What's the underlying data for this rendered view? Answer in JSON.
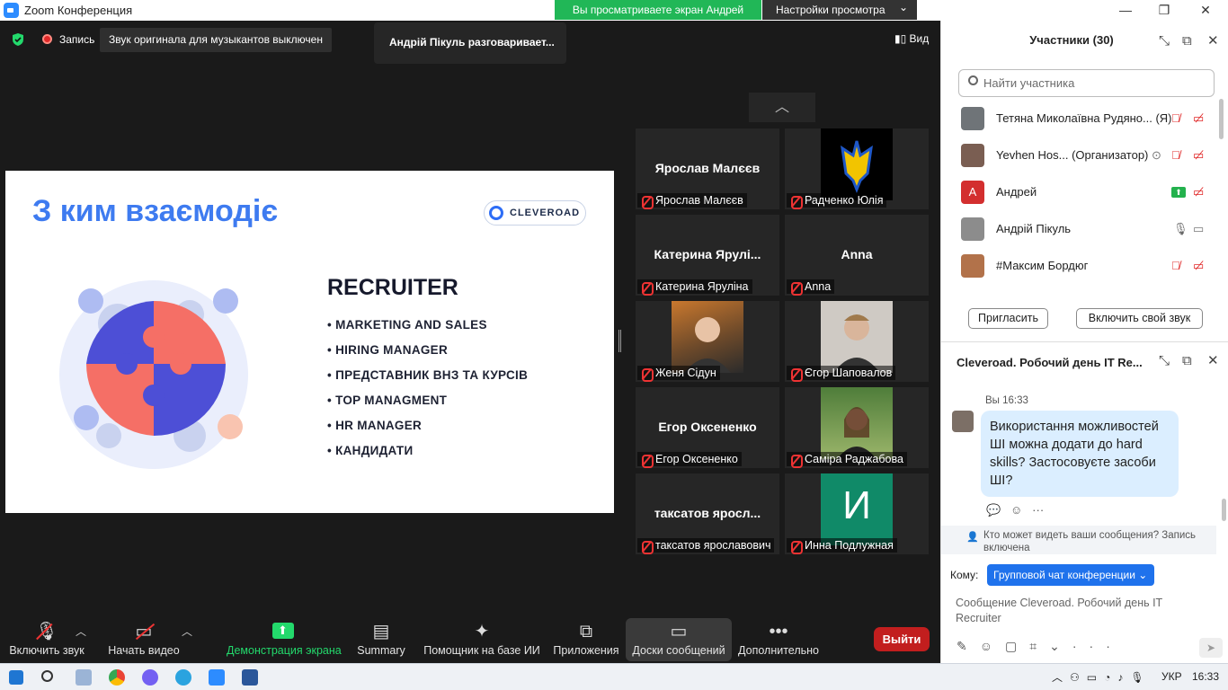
{
  "window": {
    "title": "Zoom Конференция",
    "minimize": "—",
    "restore": "❐",
    "close": "✕"
  },
  "share_banner": {
    "text": "Вы просматриваете экран Андрей",
    "settings": "Настройки просмотра",
    "chevron": "⌄"
  },
  "top": {
    "record": "Запись",
    "sound_notice": "Звук оригинала для музыкантов выключен",
    "talking": "Андрій Пікуль разговаривает...",
    "view": "Вид"
  },
  "slide": {
    "title": "З ким взаємодіє",
    "brand": "CLEVEROAD",
    "heading": "RECRUITER",
    "bullets": [
      "MARKETING AND SALES",
      "HIRING MANAGER",
      "ПРЕДСТАВНИК ВНЗ ТА КУРСІВ",
      "TOP MANAGMENT",
      "HR MANAGER",
      "КАНДИДАТИ"
    ]
  },
  "video_tiles": [
    {
      "big": "Ярослав Малєєв",
      "label": "Ярослав Малєєв"
    },
    {
      "big": "",
      "label": "Радченко Юлія",
      "image": "ukraine-trident"
    },
    {
      "big": "Катерина  Ярулі...",
      "label": "Катерина Яруліна"
    },
    {
      "big": "Anna",
      "label": "Anna"
    },
    {
      "big": "",
      "label": "Женя Сідун",
      "image": "photo"
    },
    {
      "big": "",
      "label": "Єгор Шаповалов",
      "image": "photo"
    },
    {
      "big": "Егор Оксененко",
      "label": "Егор Оксененко"
    },
    {
      "big": "",
      "label": "Саміра Раджабова",
      "image": "photo"
    },
    {
      "big": "таксатов  яросл...",
      "label": "таксатов ярославович"
    },
    {
      "big": "",
      "label": "Инна Подлужная",
      "image": "letter",
      "letter": "И"
    }
  ],
  "toolbar": {
    "mute": "Включить звук",
    "video": "Начать видео",
    "share": "Демонстрация экрана",
    "summary": "Summary",
    "ai": "Помощник на базе ИИ",
    "apps": "Приложения",
    "whiteboards": "Доски сообщений",
    "more": "Дополнительно",
    "leave": "Выйти"
  },
  "participants": {
    "title": "Участники (30)",
    "search_placeholder": "Найти участника",
    "list": [
      {
        "name": "Тетяна Миколаївна Рудяно... (Я)",
        "avatar": "",
        "mic": "muted",
        "cam": "off"
      },
      {
        "name": "Yevhen Hos...  (Организатор)",
        "avatar": "",
        "mic": "muted",
        "cam": "off"
      },
      {
        "name": "Андрей",
        "avatar": "А",
        "mic": "sharing",
        "cam": "off"
      },
      {
        "name": "Андрій Пікуль",
        "avatar": "",
        "mic": "on",
        "cam": "off-grey"
      },
      {
        "name": "#Максим Бордюг",
        "avatar": "",
        "mic": "muted",
        "cam": "off"
      }
    ],
    "invite": "Пригласить",
    "unmute": "Включить свой звук"
  },
  "chat": {
    "title": "Cleveroad. Робочий день IT Re...",
    "time": "Вы 16:33",
    "message": "Використання можливостей ШІ можна додати до hard skills? Застосовуєте засоби ШІ?",
    "privacy": "Кто может видеть ваши сообщения? Запись включена",
    "to_label": "Кому:",
    "to_value": "Групповой чат конференции ⌄",
    "placeholder": "Сообщение Cleveroad. Робочий день IT Recruiter"
  },
  "taskbar": {
    "lang": "УКР",
    "time": "16:33"
  },
  "colors": {
    "accent": "#2d8cff",
    "share_green": "#21b757",
    "leave_red": "#c21e1e",
    "muted_red": "#e02828"
  }
}
